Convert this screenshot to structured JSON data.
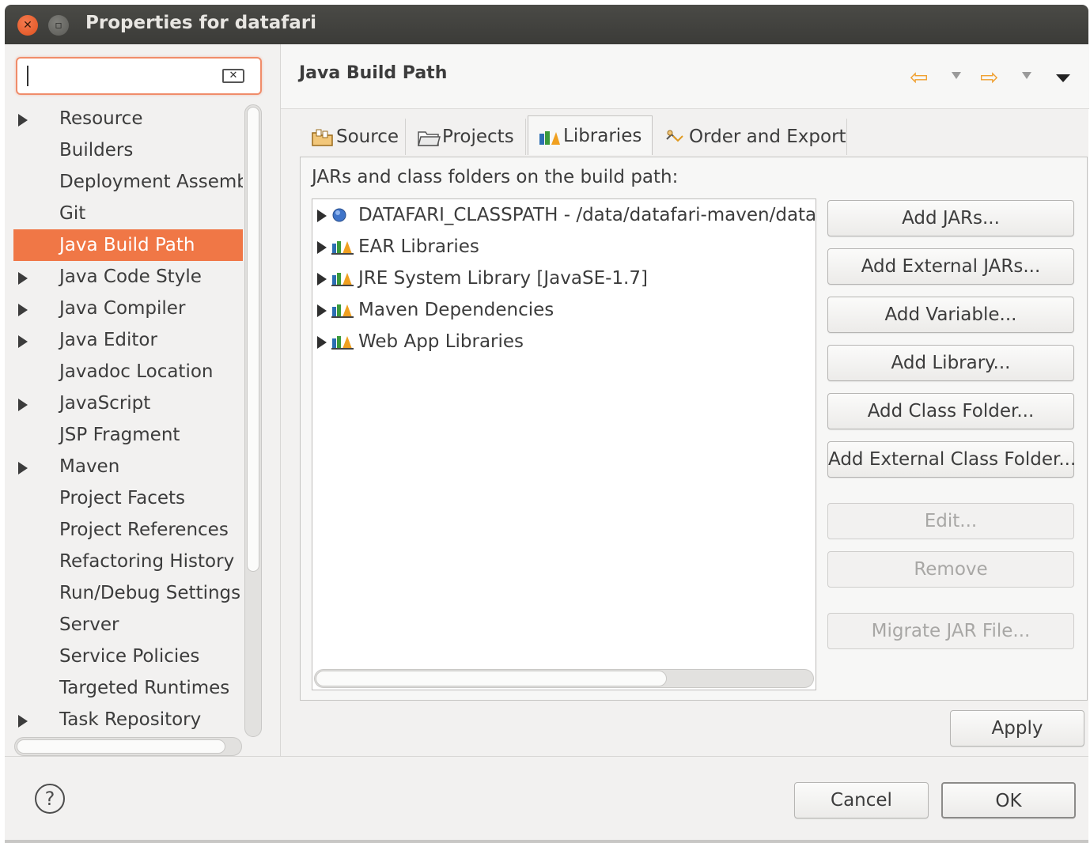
{
  "window": {
    "title": "Properties for datafari"
  },
  "filter": {
    "value": "",
    "clear_icon": "clear-text-icon"
  },
  "sidebar": {
    "items": [
      {
        "label": "Resource",
        "expandable": true
      },
      {
        "label": "Builders",
        "expandable": false
      },
      {
        "label": "Deployment Assembly",
        "expandable": false
      },
      {
        "label": "Git",
        "expandable": false
      },
      {
        "label": "Java Build Path",
        "expandable": false,
        "selected": true
      },
      {
        "label": "Java Code Style",
        "expandable": true
      },
      {
        "label": "Java Compiler",
        "expandable": true
      },
      {
        "label": "Java Editor",
        "expandable": true
      },
      {
        "label": "Javadoc Location",
        "expandable": false
      },
      {
        "label": "JavaScript",
        "expandable": true
      },
      {
        "label": "JSP Fragment",
        "expandable": false
      },
      {
        "label": "Maven",
        "expandable": true
      },
      {
        "label": "Project Facets",
        "expandable": false
      },
      {
        "label": "Project References",
        "expandable": false
      },
      {
        "label": "Refactoring History",
        "expandable": false
      },
      {
        "label": "Run/Debug Settings",
        "expandable": false
      },
      {
        "label": "Server",
        "expandable": false
      },
      {
        "label": "Service Policies",
        "expandable": false
      },
      {
        "label": "Targeted Runtimes",
        "expandable": false
      },
      {
        "label": "Task Repository",
        "expandable": true
      }
    ]
  },
  "page": {
    "title": "Java Build Path"
  },
  "tabs": [
    {
      "label": "Source",
      "icon": "source-folder-icon"
    },
    {
      "label": "Projects",
      "icon": "project-folder-icon"
    },
    {
      "label": "Libraries",
      "icon": "libraries-icon",
      "active": true
    },
    {
      "label": "Order and Export",
      "icon": "order-export-icon"
    }
  ],
  "libraries": {
    "label": "JARs and class folders on the build path:",
    "items": [
      {
        "label": "DATAFARI_CLASSPATH - /data/datafari-maven/datafari",
        "icon": "classpath-variable-icon"
      },
      {
        "label": "EAR Libraries",
        "icon": "library-icon"
      },
      {
        "label": "JRE System Library [JavaSE-1.7]",
        "icon": "library-icon"
      },
      {
        "label": "Maven Dependencies",
        "icon": "library-icon"
      },
      {
        "label": "Web App Libraries",
        "icon": "library-icon"
      }
    ]
  },
  "buttons": {
    "add_jars": "Add JARs...",
    "add_external_jars": "Add External JARs...",
    "add_variable": "Add Variable...",
    "add_library": "Add Library...",
    "add_class_folder": "Add Class Folder...",
    "add_external_class_folder": "Add External Class Folder...",
    "edit": "Edit...",
    "remove": "Remove",
    "migrate_jar": "Migrate JAR File...",
    "apply": "Apply",
    "cancel": "Cancel",
    "ok": "OK"
  },
  "colors": {
    "accent": "#f07746",
    "title_bar": "#3b3b38"
  }
}
